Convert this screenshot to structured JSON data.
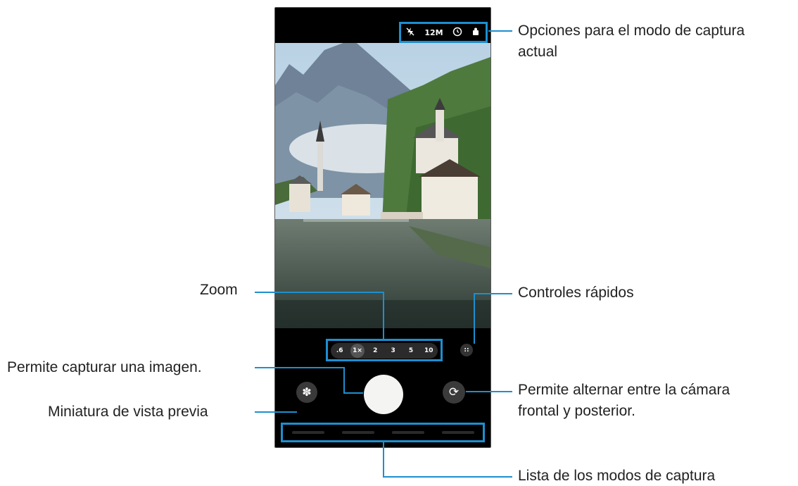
{
  "callouts": {
    "options": [
      "Opciones para el modo de captura",
      "actual"
    ],
    "quick_controls": "Controles rápidos",
    "zoom": "Zoom",
    "capture": "Permite capturar una imagen.",
    "switch_camera": [
      "Permite alternar entre la cámara",
      "frontal y posterior."
    ],
    "thumbnail": "Miniatura de vista previa",
    "modes": "Lista de los modos de captura"
  },
  "camera": {
    "options": {
      "flash_icon": "flash-off-icon",
      "resolution": "12M",
      "timer_icon": "timer-icon",
      "ratio_icon": "aspect-ratio-icon"
    },
    "zoom_levels": [
      ".6",
      "1×",
      "2",
      "3",
      "5",
      "10"
    ],
    "zoom_selected": "1×",
    "quick_controls_icon": "grid-dots-icon",
    "thumbnail_icon": "flower-icon",
    "switch_icon": "rotate-camera-icon"
  },
  "colors": {
    "accent": "#1d8fd0",
    "background": "#000000",
    "shutter": "#f4f4f2"
  }
}
